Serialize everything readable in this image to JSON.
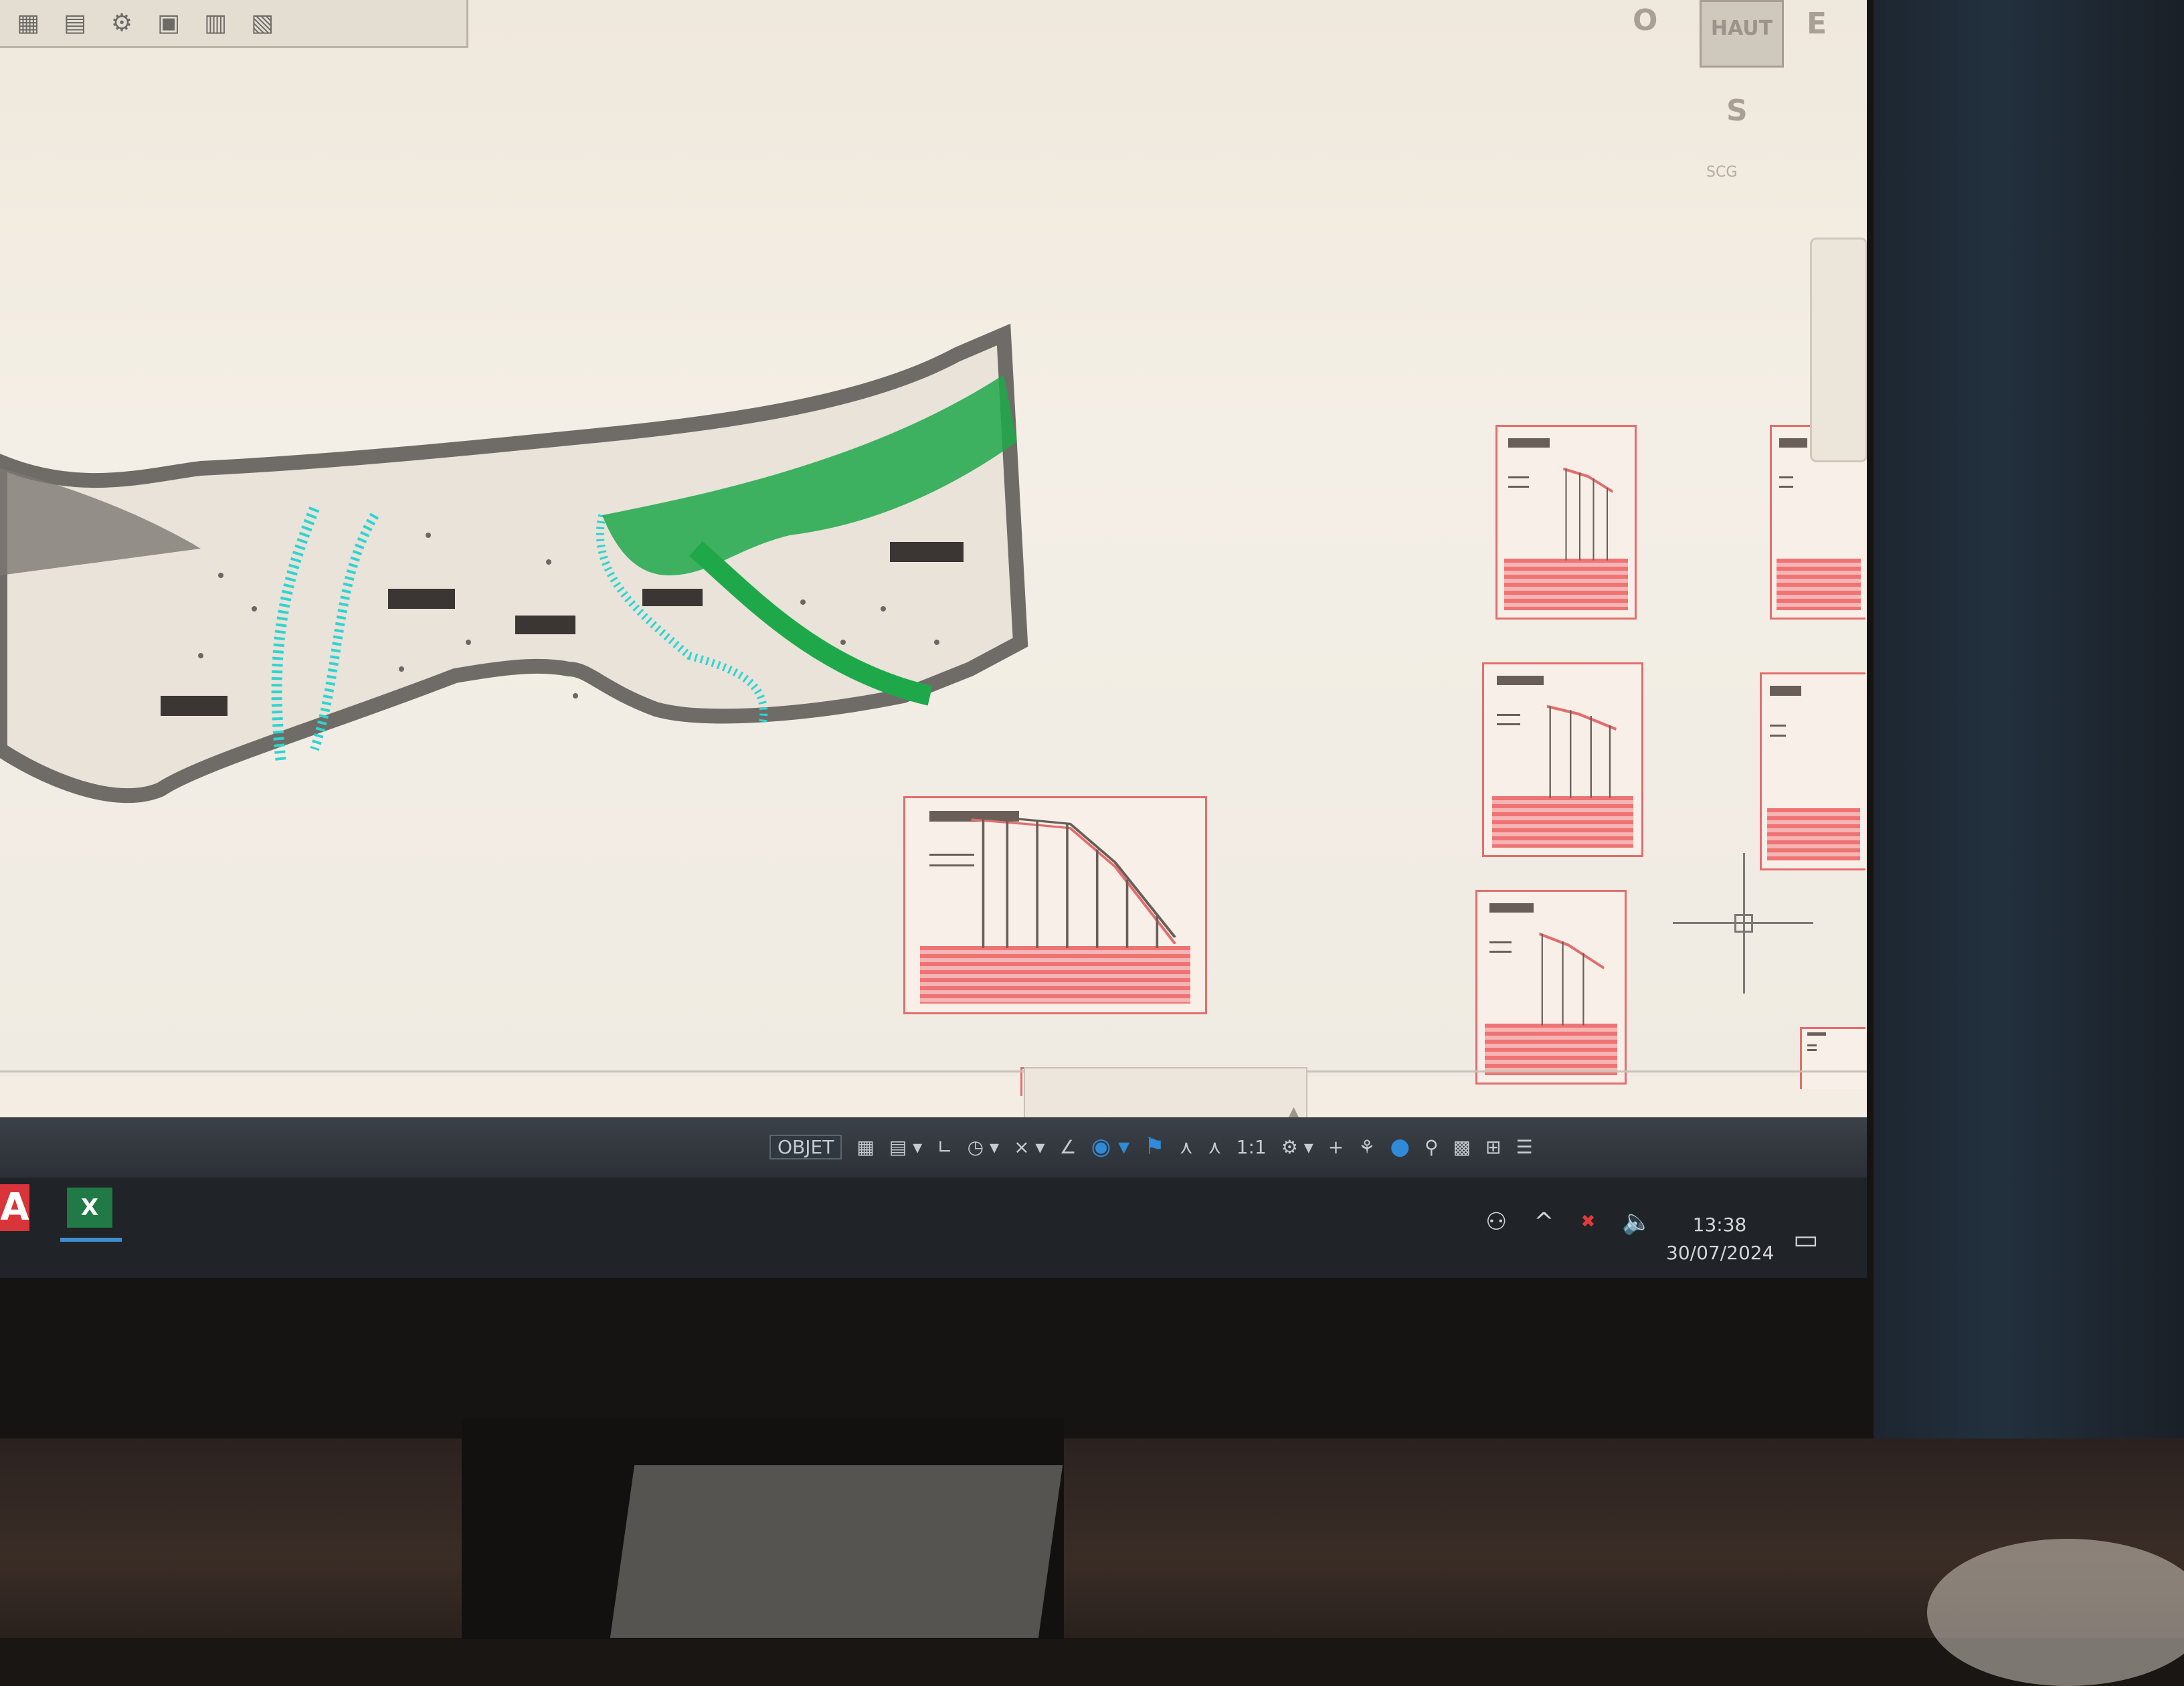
{
  "autocad": {
    "toolbar_icons": [
      "layers-icon",
      "properties-icon",
      "match-icon",
      "groups-icon",
      "block-icon",
      "utilities-icon"
    ],
    "viewcube": {
      "top": "HAUT",
      "east": "E",
      "west": "O",
      "south": "S",
      "ucs": "SCG"
    },
    "status_bar": {
      "model_label": "OBJET",
      "scale": "1:1"
    },
    "colors": {
      "slope_cyan": "#2fd4d0",
      "vegetation_green": "#1fa84a",
      "profile_red": "#e36d6d"
    }
  },
  "taskbar": {
    "apps": [
      "A",
      "X"
    ],
    "time": "13:38",
    "date": "30/07/2024"
  }
}
